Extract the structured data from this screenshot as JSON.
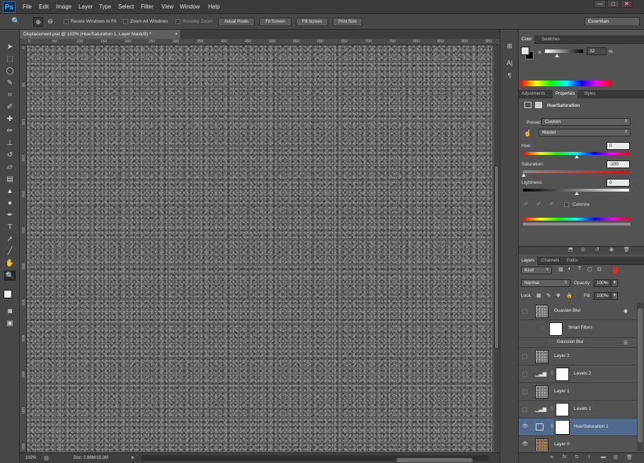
{
  "app": {
    "logo": "Ps"
  },
  "menu": [
    "File",
    "Edit",
    "Image",
    "Layer",
    "Type",
    "Select",
    "Filter",
    "View",
    "Window",
    "Help"
  ],
  "window_controls": [
    "—",
    "□",
    "✕"
  ],
  "options_bar": {
    "resize_windows": "Resize Windows to Fit",
    "zoom_all": "Zoom All Windows",
    "scrubby_zoom": "Scrubby Zoom",
    "actual_pixels": "Actual Pixels",
    "fit_screen": "Fit Screen",
    "fill_screen": "Fill Screen",
    "print_size": "Print Size",
    "workspace": "Essentials"
  },
  "document": {
    "tab_title": "Displacement.psd @ 102% (Hue/Saturation 1, Layer Mask/8) *",
    "zoom": "102%",
    "doc_size": "Doc: 2.86M/15.3M"
  },
  "ruler_top": [
    "0",
    "50",
    "100",
    "150",
    "200",
    "250",
    "300",
    "350",
    "400",
    "450",
    "500",
    "550",
    "600",
    "650",
    "700",
    "750",
    "800",
    "850",
    "900",
    "950"
  ],
  "ruler_left": [
    "0",
    "50",
    "100",
    "150",
    "200",
    "250",
    "300",
    "350",
    "400",
    "450",
    "500",
    "550"
  ],
  "color_panel": {
    "tabs": [
      "Color",
      "Swatches"
    ],
    "channel": "K",
    "value": "32",
    "unit": "%",
    "k_level": 0.32
  },
  "properties_panel": {
    "tabs": [
      "Adjustments",
      "Properties",
      "Styles"
    ],
    "title": "Hue/Saturation",
    "preset_label": "Preset:",
    "preset_value": "Custom",
    "channel_value": "Master",
    "hue_label": "Hue:",
    "hue_value": "0",
    "saturation_label": "Saturation:",
    "saturation_value": "-100",
    "lightness_label": "Lightness:",
    "lightness_value": "0",
    "colorize_label": "Colorize"
  },
  "layers_panel": {
    "tabs": [
      "Layers",
      "Channels",
      "Paths"
    ],
    "filter_kind": "Kind",
    "blend_mode": "Normal",
    "opacity_label": "Opacity:",
    "opacity_value": "100%",
    "lock_label": "Lock:",
    "fill_label": "Fill:",
    "fill_value": "100%",
    "layers": [
      {
        "name": "Guasian Blur",
        "thumb": "texture",
        "visible": false
      },
      {
        "name": "Smart Filters",
        "thumb": "white",
        "visible": false
      },
      {
        "name": "Gaussian Blur",
        "thumb": "none",
        "visible": false
      },
      {
        "name": "Layer 2",
        "thumb": "texture",
        "visible": false
      },
      {
        "name": "Levels 2",
        "thumb": "white",
        "visible": false
      },
      {
        "name": "Layer 1",
        "thumb": "texture",
        "visible": false
      },
      {
        "name": "Levels 1",
        "thumb": "white",
        "visible": false
      },
      {
        "name": "Hue/Saturation 1",
        "thumb": "white",
        "visible": true,
        "selected": true
      },
      {
        "name": "Layer 0",
        "thumb": "brown",
        "visible": true
      }
    ]
  },
  "colors": {
    "panel_bg": "#535353",
    "selected_layer": "#4f6a8c",
    "chrome": "#3b3b3b"
  }
}
